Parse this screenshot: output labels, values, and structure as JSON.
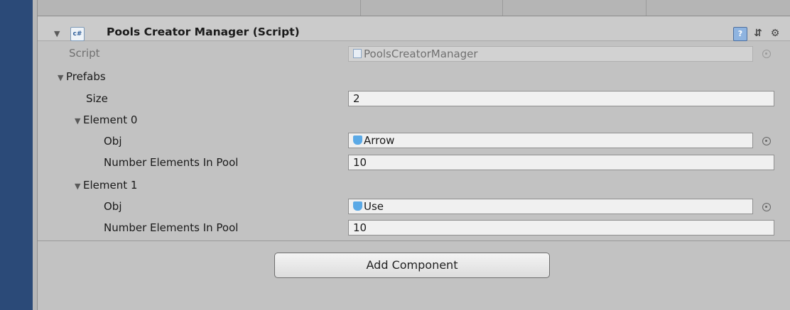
{
  "component": {
    "title": "Pools Creator Manager (Script)",
    "script_label": "Script",
    "script_value": "PoolsCreatorManager"
  },
  "prefabs": {
    "label": "Prefabs",
    "size_label": "Size",
    "size_value": "2",
    "elements": [
      {
        "label": "Element 0",
        "obj_label": "Obj",
        "obj_value": "Arrow",
        "count_label": "Number Elements In Pool",
        "count_value": "10"
      },
      {
        "label": "Element 1",
        "obj_label": "Obj",
        "obj_value": "Use",
        "count_label": "Number Elements In Pool",
        "count_value": "10"
      }
    ]
  },
  "add_component_label": "Add Component",
  "icons": {
    "foldout": "triangle-down-icon",
    "script": "csharp-script-icon",
    "help": "book-help-icon",
    "presets": "sliders-icon",
    "settings": "gear-icon",
    "object_picker": "object-picker-icon",
    "gameobject": "cube-icon"
  },
  "colors": {
    "background": "#c2c2c2",
    "left_panel": "#2b4a78",
    "field": "#f0f0f0",
    "field_disabled": "#d2d2d2"
  }
}
